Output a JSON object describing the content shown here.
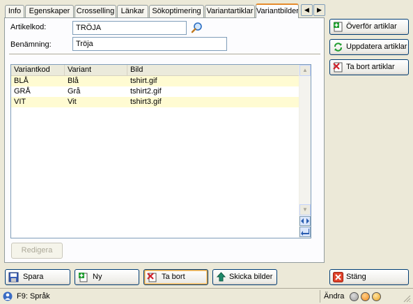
{
  "tabs": [
    "Info",
    "Egenskaper",
    "Crosselling",
    "Länkar",
    "Sökoptimering",
    "Variantartiklar",
    "Variantbilder"
  ],
  "tab_scroll": {
    "left": "◀",
    "right": "▶"
  },
  "form": {
    "artikelkod_label": "Artikelkod:",
    "artikelkod_value": "TRÖJA",
    "benamning_label": "Benämning:",
    "benamning_value": "Tröja"
  },
  "grid": {
    "columns": [
      "Variantkod",
      "Variant",
      "Bild"
    ],
    "rows": [
      {
        "kod": "BLÅ",
        "variant": "Blå",
        "bild": "tshirt.gif"
      },
      {
        "kod": "GRÅ",
        "variant": "Grå",
        "bild": "tshirt2.gif"
      },
      {
        "kod": "VIT",
        "variant": "Vit",
        "bild": "tshirt3.gif"
      }
    ]
  },
  "buttons": {
    "redigera": "Redigera",
    "overfor": "Överför artiklar",
    "uppdatera": "Uppdatera artiklar",
    "tabort_artiklar": "Ta bort artiklar",
    "spara": "Spara",
    "ny": "Ny",
    "tabort": "Ta bort",
    "skicka": "Skicka bilder",
    "stang": "Stäng"
  },
  "status": {
    "help": "F9: Språk",
    "mode": "Ändra"
  },
  "colors": {
    "row_highlight": "#fffbd2",
    "tab_active_accent": "#e68b2c",
    "lamp_colors": [
      "#9c9c9c",
      "#f08a1c",
      "#e8a020"
    ]
  }
}
